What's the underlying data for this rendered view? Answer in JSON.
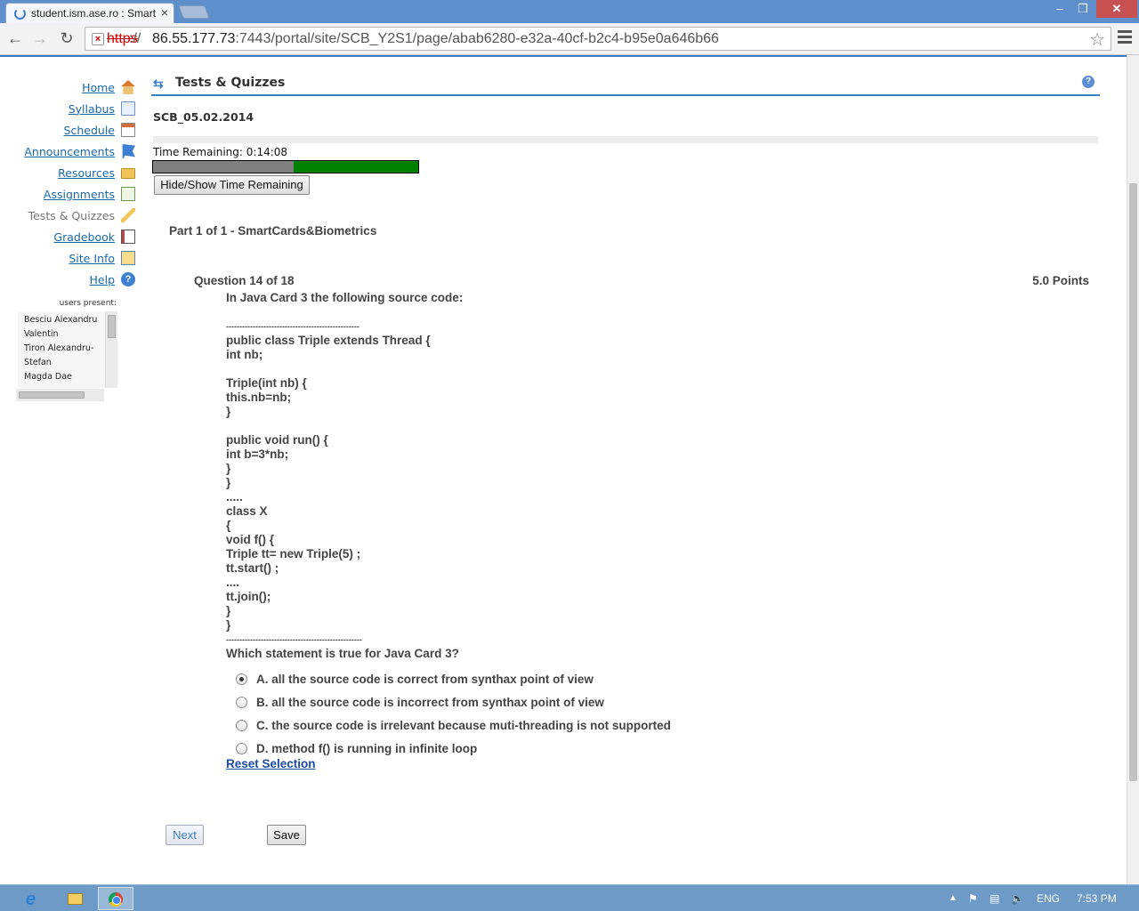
{
  "browser": {
    "tab_title": "student.ism.ase.ro : Smart",
    "tab_close": "×",
    "url_scheme": "https",
    "url_sep": "://",
    "url_host": "86.55.177.73",
    "url_path": ":7443/portal/site/SCB_Y2S1/page/abab6280-e32a-40cf-b2c4-b95e0a646b66"
  },
  "tools": [
    {
      "label": "Home",
      "icon": "home-icon",
      "current": false
    },
    {
      "label": "Syllabus",
      "icon": "syllabus-icon",
      "current": false
    },
    {
      "label": "Schedule",
      "icon": "calendar-icon",
      "current": false
    },
    {
      "label": "Announcements",
      "icon": "flag-icon",
      "current": false
    },
    {
      "label": "Resources",
      "icon": "folder-icon",
      "current": false
    },
    {
      "label": "Assignments",
      "icon": "edit-icon",
      "current": false
    },
    {
      "label": "Tests & Quizzes",
      "icon": "pencil-icon",
      "current": true
    },
    {
      "label": "Gradebook",
      "icon": "book-icon",
      "current": false
    },
    {
      "label": "Site Info",
      "icon": "info-icon",
      "current": false
    },
    {
      "label": "Help",
      "icon": "help-icon",
      "current": false
    }
  ],
  "presence": {
    "title": "users present:",
    "users": [
      "Besciu Alexandru",
      "Valentin",
      "Tiron Alexandru-",
      "Stefan",
      "Magda Dae"
    ]
  },
  "portlet": {
    "title": "Tests & Quizzes"
  },
  "assessment": {
    "title": "SCB_05.02.2014",
    "time_remaining": "Time Remaining: 0:14:08",
    "time_elapsed_fraction": 0.53,
    "hide_show_button": "Hide/Show Time Remaining",
    "part_title": "Part 1 of 1 -  SmartCards&Biometrics"
  },
  "question": {
    "header": "Question 14 of 18",
    "points": "5.0 Points",
    "lines": [
      "In Java Card 3 the following source code:",
      "",
      "--------------------------------------------------",
      "public class Triple extends Thread {",
      "int nb;",
      "",
      "Triple(int nb) {",
      "this.nb=nb;",
      "}",
      "",
      "public void run() {",
      "int b=3*nb;",
      "}",
      "}",
      ".....",
      "class X",
      "{",
      "void f() {",
      "Triple tt= new Triple(5) ;",
      "tt.start() ;",
      "....",
      "tt.join();",
      "}",
      "}",
      "---------------------------------------------------",
      "Which statement is true for Java Card 3?"
    ],
    "choices": [
      {
        "label": "A. all the source code is correct from synthax point of view",
        "selected": true
      },
      {
        "label": "B. all the source code is incorrect from synthax point of view",
        "selected": false
      },
      {
        "label": "C. the source code is irrelevant because muti-threading is not supported",
        "selected": false
      },
      {
        "label": "D. method f() is running in infinite loop",
        "selected": false
      }
    ],
    "reset_label": "Reset Selection"
  },
  "actions": {
    "next": "Next",
    "save": "Save"
  },
  "taskbar": {
    "language": "ENG",
    "clock": "7:53 PM"
  },
  "colors": {
    "accent": "#3a80c6",
    "link": "#1a68a8",
    "time_bar_remaining": "#008000",
    "time_bar_elapsed": "#808080"
  }
}
